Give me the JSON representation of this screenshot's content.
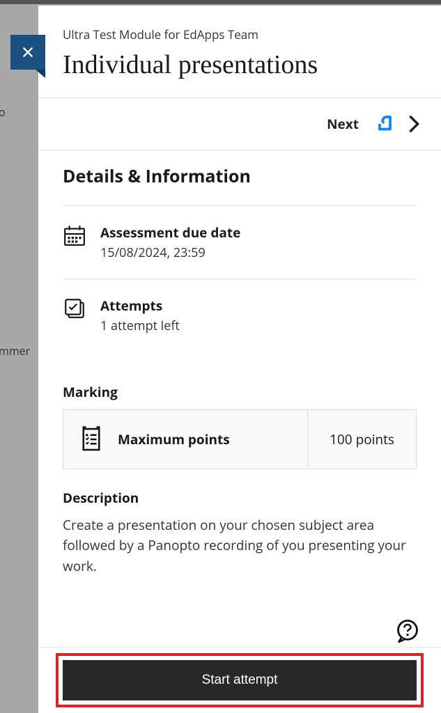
{
  "breadcrumb": "Ultra Test Module for EdApps Team",
  "title": "Individual presentations",
  "nav": {
    "next": "Next"
  },
  "details": {
    "section_title": "Details & Information",
    "due_date": {
      "label": "Assessment due date",
      "value": "15/08/2024, 23:59"
    },
    "attempts": {
      "label": "Attempts",
      "value": "1 attempt left"
    }
  },
  "marking": {
    "label": "Marking",
    "row_label": "Maximum points",
    "row_value": "100 points"
  },
  "description": {
    "label": "Description",
    "text": "Create a presentation on your chosen subject area followed by a Panopto recording of you presenting your work."
  },
  "footer": {
    "start": "Start attempt"
  },
  "bg": {
    "item1": "o",
    "item2": "mmer"
  }
}
